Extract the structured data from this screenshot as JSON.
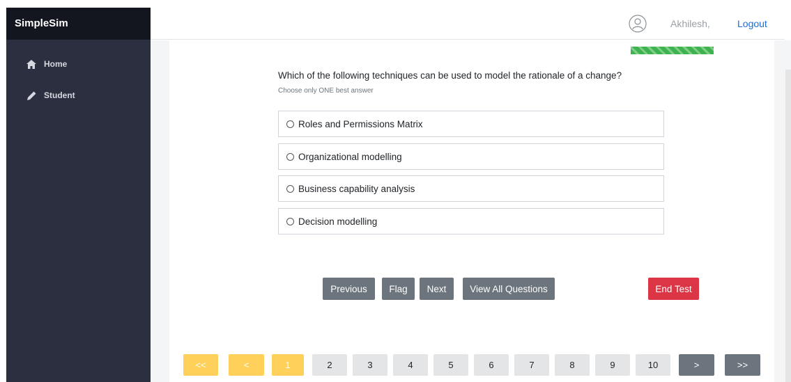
{
  "app": {
    "title": "SimpleSim"
  },
  "sidebar": {
    "items": [
      {
        "label": "Home",
        "icon": "home-icon"
      },
      {
        "label": "Student",
        "icon": "pencil-icon"
      }
    ]
  },
  "header": {
    "username": "Akhilesh,",
    "logout_label": "Logout"
  },
  "question": {
    "text": "Which of the following techniques can be used to model the rationale of a change?",
    "instruction": "Choose only ONE best answer",
    "options": [
      "Roles and Permissions Matrix",
      "Organizational modelling",
      "Business capability analysis",
      "Decision modelling"
    ]
  },
  "actions": {
    "previous": "Previous",
    "flag": "Flag",
    "next": "Next",
    "view_all": "View All Questions",
    "end_test": "End Test"
  },
  "pagination": {
    "first": "<<",
    "prev": "<",
    "pages": [
      "1",
      "2",
      "3",
      "4",
      "5",
      "6",
      "7",
      "8",
      "9",
      "10"
    ],
    "current": "1",
    "next": ">",
    "last": ">>"
  },
  "colors": {
    "sidebar": "#2b2f40",
    "brand": "#13161f",
    "accent_progress": "#3fb34f",
    "end_test": "#dc3545",
    "pagination_active": "#ffd05a",
    "button_gray": "#6c757d"
  }
}
